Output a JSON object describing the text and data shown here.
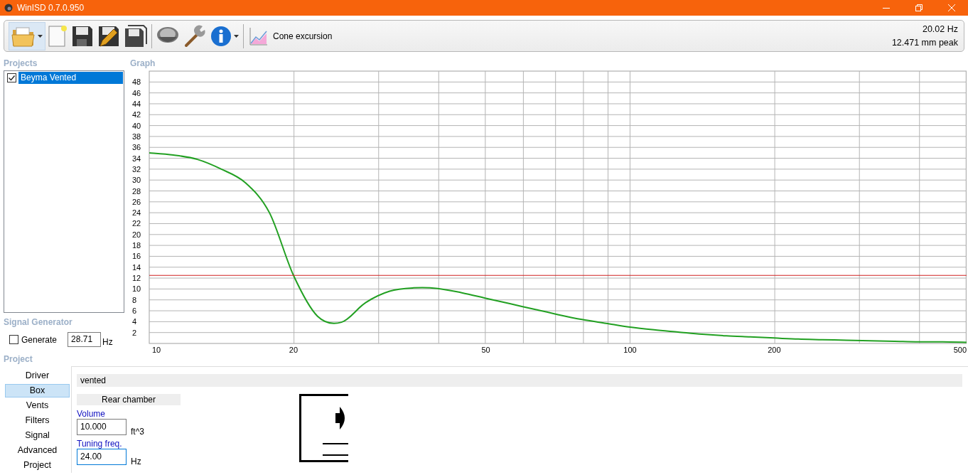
{
  "window": {
    "title": "WinISD 0.7.0.950"
  },
  "toolbar": {
    "graph_button": {
      "label": "Cone excursion"
    },
    "readout": [
      "20.02 Hz",
      "12.471 mm peak"
    ]
  },
  "projects": {
    "heading": "Projects",
    "items": [
      {
        "label": "Beyma Vented",
        "checked": true,
        "selected": true
      }
    ]
  },
  "graph": {
    "heading": "Graph",
    "chart_data": {
      "type": "line",
      "categories": [
        "10",
        null,
        null,
        null,
        null,
        null,
        "20",
        null,
        null,
        null,
        null,
        null,
        null,
        null,
        "50",
        null,
        null,
        null,
        null,
        null,
        "100",
        null,
        null,
        null,
        null,
        null,
        "200",
        null,
        null,
        null,
        null,
        null,
        null,
        null,
        "500"
      ],
      "series": [
        {
          "color": "#22a022",
          "values": [
            35,
            34.6,
            33.8,
            32,
            29.5,
            24,
            12.5,
            5,
            3.9,
            7.5,
            9.6,
            10.2,
            10.1,
            9.3,
            8.3,
            7.3,
            6.3,
            5.3,
            4.4,
            3.7,
            3,
            2.5,
            2.1,
            1.7,
            1.4,
            1.2,
            1,
            0.8,
            0.7,
            0.6,
            0.5,
            0.4,
            0.3,
            0.3,
            0.2
          ]
        },
        {
          "color": "#d02020",
          "values": [
            12.5,
            12.5,
            12.5,
            12.5,
            12.5,
            12.5,
            12.5,
            12.5,
            12.5,
            12.5,
            12.5,
            12.5,
            12.5,
            12.5,
            12.5,
            12.5,
            12.5,
            12.5,
            12.5,
            12.5,
            12.5,
            12.5,
            12.5,
            12.5,
            12.5,
            12.5,
            12.5,
            12.5,
            12.5,
            12.5,
            12.5,
            12.5,
            12.5,
            12.5,
            12.5
          ]
        }
      ],
      "ylim": [
        0,
        50
      ],
      "grid": true,
      "yticks": [
        2,
        4,
        6,
        8,
        10,
        12,
        14,
        16,
        18,
        20,
        22,
        24,
        26,
        28,
        30,
        32,
        34,
        36,
        38,
        40,
        42,
        44,
        46,
        48
      ]
    }
  },
  "signal_generator": {
    "heading": "Signal Generator",
    "generate": {
      "label": "Generate",
      "checked": false
    },
    "frequency": "28.71",
    "unit": "Hz"
  },
  "project": {
    "heading": "Project",
    "tabs": [
      {
        "label": "Driver",
        "selected": false
      },
      {
        "label": "Box",
        "selected": true
      },
      {
        "label": "Vents",
        "selected": false
      },
      {
        "label": "Filters",
        "selected": false
      },
      {
        "label": "Signal",
        "selected": false
      },
      {
        "label": "Advanced",
        "selected": false
      },
      {
        "label": "Project",
        "selected": false
      }
    ],
    "box_type": "vented",
    "section": "Rear chamber",
    "fields": [
      {
        "label": "Volume",
        "value": "10.000",
        "unit": "ft^3",
        "focused": false
      },
      {
        "label": "Tuning freq.",
        "value": "24.00",
        "unit": "Hz",
        "focused": true
      }
    ]
  }
}
